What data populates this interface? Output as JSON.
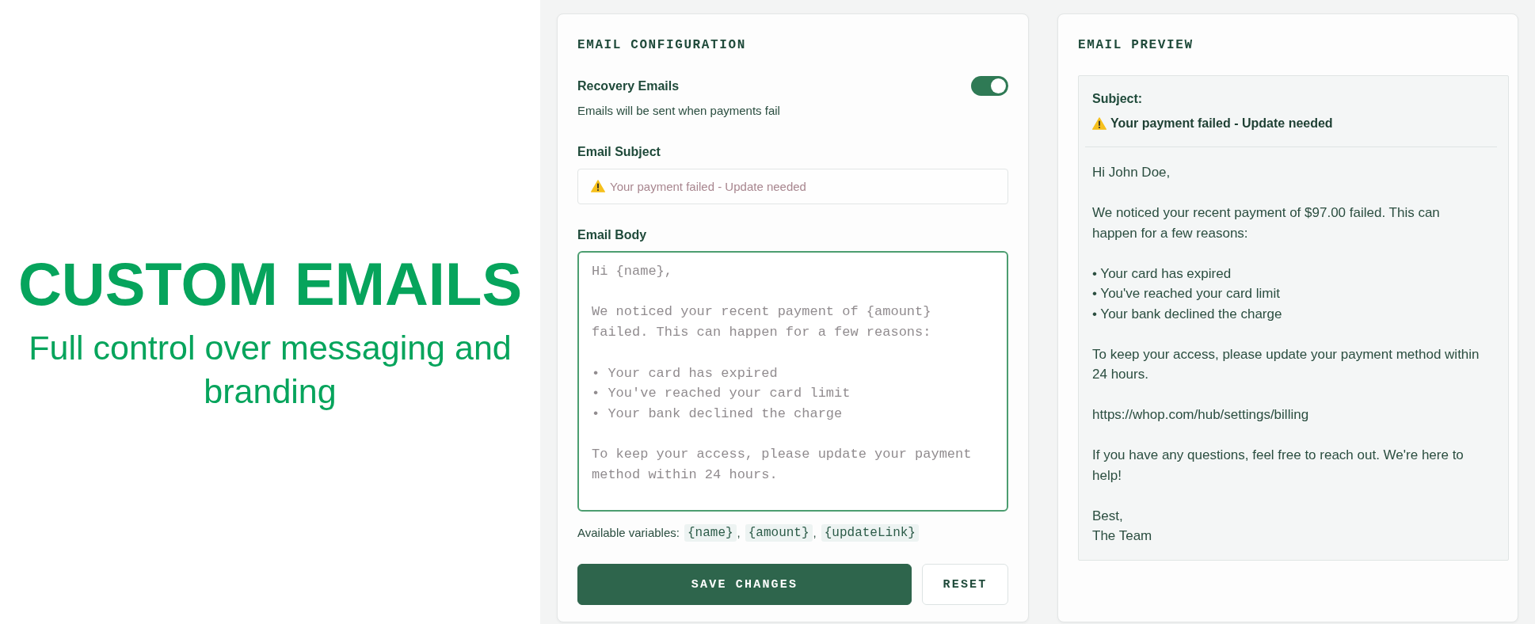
{
  "hero": {
    "title": "CUSTOM EMAILS",
    "subtitle": "Full control over messaging and branding"
  },
  "config": {
    "title": "EMAIL CONFIGURATION",
    "recovery": {
      "label": "Recovery Emails",
      "description": "Emails will be sent when payments fail",
      "on": true
    },
    "subject": {
      "label": "Email Subject",
      "placeholder": "Your payment failed - Update needed"
    },
    "body": {
      "label": "Email Body",
      "placeholder": "Hi {name},\n\nWe noticed your recent payment of {amount} failed. This can happen for a few reasons:\n\n• Your card has expired\n• You've reached your card limit\n• Your bank declined the charge\n\nTo keep your access, please update your payment method within 24 hours."
    },
    "variables": [
      {
        "kind": "text",
        "text": "Available variables:"
      },
      {
        "kind": "code",
        "text": "{name}"
      },
      {
        "kind": "text",
        "text": ","
      },
      {
        "kind": "code",
        "text": "{amount}"
      },
      {
        "kind": "text",
        "text": ","
      },
      {
        "kind": "code",
        "text": "{updateLink}"
      }
    ],
    "buttons": [
      {
        "kind": "primary",
        "label": "SAVE CHANGES"
      },
      {
        "kind": "secondary",
        "label": "RESET"
      }
    ]
  },
  "preview": {
    "title": "EMAIL PREVIEW",
    "subject_label": "Subject:",
    "subject": "Your payment failed - Update needed",
    "body": [
      {
        "lines": [
          "Hi John Doe,"
        ]
      },
      {
        "lines": [
          "We noticed your recent payment of $97.00 failed. This can happen for a few reasons:"
        ]
      },
      {
        "lines": [
          "• Your card has expired",
          "• You've reached your card limit",
          "• Your bank declined the charge"
        ]
      },
      {
        "lines": [
          "To keep your access, please update your payment method within 24 hours."
        ]
      },
      {
        "lines": [
          "https://whop.com/hub/settings/billing"
        ]
      },
      {
        "lines": [
          "If you have any questions, feel free to reach out. We're here to help!"
        ]
      },
      {
        "lines": [
          "Best,",
          "The Team"
        ]
      }
    ]
  }
}
